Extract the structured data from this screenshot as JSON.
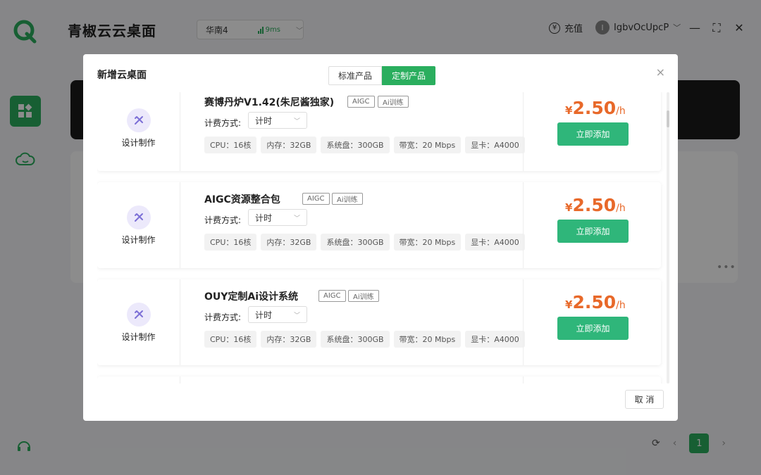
{
  "app": {
    "title": "青椒云云桌面",
    "region": "华南4",
    "latency": "9ms",
    "recharge_label": "充值",
    "recharge_icon": "yen-icon",
    "username": "IgbvOcUpcP",
    "avatar_letter": "I",
    "accent_color": "#2aae5e"
  },
  "pagination": {
    "current_page": "1"
  },
  "modal": {
    "title": "新增云桌面",
    "tabs": [
      {
        "label": "标准产品",
        "active": false
      },
      {
        "label": "定制产品",
        "active": true
      }
    ],
    "close_icon": "×",
    "cancel_label": "取 消"
  },
  "products": [
    {
      "category": "设计制作",
      "name": "赛博丹炉V1.42(朱尼酱独家)",
      "tags": [
        "AIGC",
        "Ai训练"
      ],
      "billing_label": "计费方式:",
      "billing_value": "计时",
      "specs": [
        "CPU：16核",
        "内存：32GB",
        "系统盘：300GB",
        "带宽：20 Mbps",
        "显卡：A4000"
      ],
      "price_currency": "¥",
      "price_value": "2.50",
      "price_unit": "/h",
      "add_label": "立即添加"
    },
    {
      "category": "设计制作",
      "name": "AIGC资源整合包",
      "tags": [
        "AIGC",
        "Ai训练"
      ],
      "billing_label": "计费方式:",
      "billing_value": "计时",
      "specs": [
        "CPU：16核",
        "内存：32GB",
        "系统盘：300GB",
        "带宽：20 Mbps",
        "显卡：A4000"
      ],
      "price_currency": "¥",
      "price_value": "2.50",
      "price_unit": "/h",
      "add_label": "立即添加"
    },
    {
      "category": "设计制作",
      "name": "OUY定制Ai设计系统",
      "tags": [
        "AIGC",
        "Ai训练"
      ],
      "billing_label": "计费方式:",
      "billing_value": "计时",
      "specs": [
        "CPU：16核",
        "内存：32GB",
        "系统盘：300GB",
        "带宽：20 Mbps",
        "显卡：A4000"
      ],
      "price_currency": "¥",
      "price_value": "2.50",
      "price_unit": "/h",
      "add_label": "立即添加"
    }
  ]
}
